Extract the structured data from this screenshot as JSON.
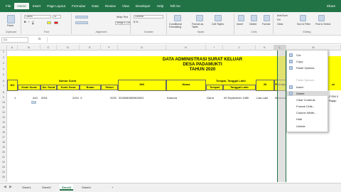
{
  "ribbon_tabs": [
    "File",
    "Home",
    "Insert",
    "Page Layout",
    "Formulas",
    "Data",
    "Review",
    "View",
    "Developer",
    "Help",
    "Tell me"
  ],
  "ribbon_tabs_right": "Share",
  "ribbon": {
    "clipboard_label": "Clipboard",
    "paste_label": "Paste",
    "font_label": "Font",
    "font_name": "Calibri",
    "font_size": "11",
    "alignment_label": "Alignment",
    "wrap_text": "Wrap Text",
    "merge_center": "Merge & Center",
    "number_label": "Number",
    "number_format": "General",
    "styles_label": "Styles",
    "cond_format": "Conditional Formatting",
    "format_table": "Format as Table",
    "cell_styles": "Cell Styles",
    "cells_label": "Cells",
    "insert": "Insert",
    "delete": "Delete",
    "format": "Format",
    "editing_label": "Editing",
    "autosum": "AutoSum",
    "fill": "Fill",
    "clear": "Clear",
    "sort_filter": "Sort & Filter",
    "find_select": "Find & Select"
  },
  "formula_bar": {
    "name_box": "C1",
    "fx": "fx"
  },
  "columns": [
    "A",
    "B",
    "C",
    "D",
    "E",
    "F",
    "G",
    "H",
    "I",
    "J",
    "K",
    "L",
    "M"
  ],
  "rows": [
    "1",
    "2",
    "3",
    "4",
    "5",
    "6",
    "7",
    "8",
    "9",
    "10",
    "11",
    "12",
    "13",
    "14",
    "15",
    "16",
    "17",
    "18",
    "19",
    "20",
    "21",
    "22",
    "23",
    "24",
    "25"
  ],
  "sheet": {
    "title1": "DATA ADMINISTRASI SURAT KELUAR",
    "title2": "DESA PADAMUKTI",
    "title3": "TAHUN 2020",
    "headers": {
      "no": "NO",
      "nomor_surat": "Nomor Surat",
      "kode_surat": "Kode Surat",
      "no_surat": "No. Surat",
      "kode_desa": "Kode Desa",
      "bulan": "Bulan",
      "tahun": "Tahun",
      "nik": "NIK",
      "nama": "Nama",
      "ttl": "Tempat, Tanggal Lahir",
      "tempat": "Tempat",
      "tanggal_lahir": "Tanggal Lahir",
      "jk": "JK",
      "pekerjaan": "Pekerja",
      "last": "at"
    },
    "row1": {
      "no": "1",
      "kode_surat": "443",
      "no_surat": "0001",
      "kode_desa": "2010",
      "bulan": "X",
      "tahun": "2020",
      "nik": "3205080809800001",
      "nama": "Kamora",
      "tempat": "Garut",
      "tanggal_lahir": "09 September 1980",
      "jk": "Laki-Laki",
      "pekerjaan": "Wiraswa",
      "right1": "2 RW 0",
      "right2": "Rajap"
    }
  },
  "context_menu": [
    {
      "label": "Cut",
      "disabled": false,
      "highlight": false
    },
    {
      "label": "Copy",
      "disabled": false,
      "highlight": false
    },
    {
      "label": "Paste Options:",
      "disabled": false,
      "highlight": false
    },
    {
      "label": "",
      "disabled": true,
      "highlight": false
    },
    {
      "label": "Paste Special...",
      "disabled": true,
      "highlight": false
    },
    {
      "label": "Insert",
      "disabled": false,
      "highlight": false
    },
    {
      "label": "Delete",
      "disabled": false,
      "highlight": true
    },
    {
      "label": "Clear Contents",
      "disabled": false,
      "highlight": false
    },
    {
      "label": "Format Cells...",
      "disabled": false,
      "highlight": false
    },
    {
      "label": "Column Width...",
      "disabled": false,
      "highlight": false
    },
    {
      "label": "Hide",
      "disabled": false,
      "highlight": false
    },
    {
      "label": "Unhide",
      "disabled": false,
      "highlight": false
    }
  ],
  "sheet_tabs": [
    "Sheet1",
    "Sheet2",
    "Sheet3",
    "Sheet4"
  ],
  "active_sheet": "Sheet3",
  "add_sheet": "+",
  "colors": {
    "excel_green": "#217346",
    "highlight_yellow": "#ffff00"
  }
}
